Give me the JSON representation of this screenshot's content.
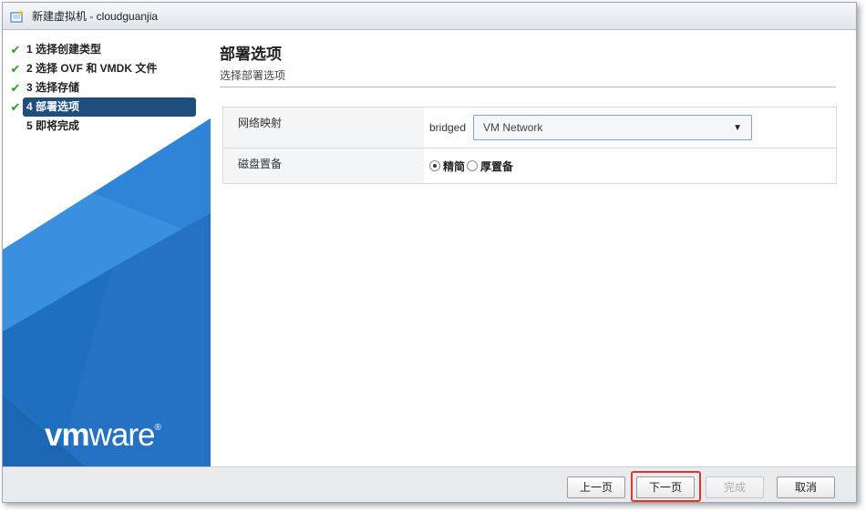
{
  "window": {
    "title": "新建虚拟机 - cloudguanjia"
  },
  "icons": {
    "title_icon": "new-vm-icon",
    "check_icon": "checkmark-icon",
    "dropdown_icon": "caret-down-icon"
  },
  "colors": {
    "accent_blue": "#1d4e7d",
    "sidebar_blue": "#1f6fbf",
    "check_green": "#3a9a2b",
    "highlight_red": "#e5332a"
  },
  "sidebar": {
    "steps": [
      {
        "label": "1 选择创建类型",
        "done": true,
        "active": false
      },
      {
        "label": "2 选择 OVF 和 VMDK 文件",
        "done": true,
        "active": false
      },
      {
        "label": "3 选择存储",
        "done": true,
        "active": false
      },
      {
        "label": "4 部署选项",
        "done": true,
        "active": true
      },
      {
        "label": "5 即将完成",
        "done": false,
        "active": false
      }
    ],
    "logo": {
      "vm": "vm",
      "ware": "ware",
      "reg": "®"
    }
  },
  "main": {
    "title": "部署选项",
    "subtitle": "选择部署选项",
    "network_mapping": {
      "label": "网络映射",
      "source": "bridged",
      "selected": "VM Network"
    },
    "disk_provisioning": {
      "label": "磁盘置备",
      "options": [
        {
          "label": "精简",
          "selected": true
        },
        {
          "label": "厚置备",
          "selected": false
        }
      ]
    }
  },
  "footer": {
    "prev_label": "上一页",
    "next_label": "下一页",
    "finish_label": "完成",
    "cancel_label": "取消"
  }
}
